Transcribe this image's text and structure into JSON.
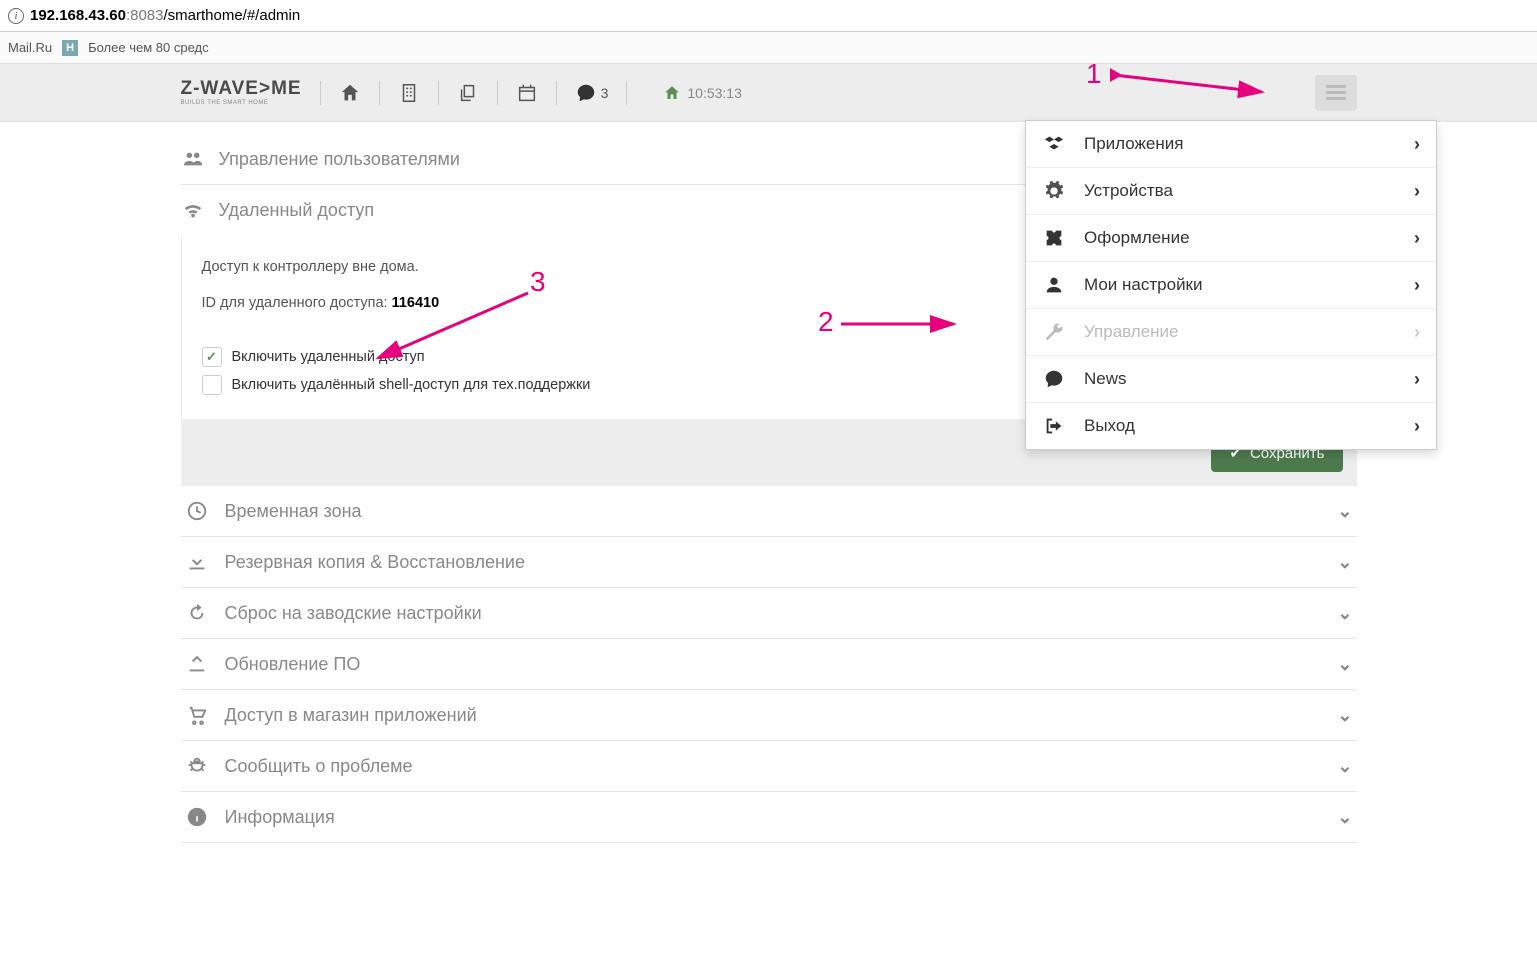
{
  "address": {
    "ip": "192.168.43.60",
    "port": ":8083",
    "path": "/smarthome/#/admin"
  },
  "bookmarks": {
    "mailru": "Mail.Ru",
    "more": "Более чем 80 средс"
  },
  "logo": {
    "main": "Z-WAVE>ME",
    "sub": "BUILDS THE SMART HOME"
  },
  "topnav": {
    "msg_count": "3",
    "time": "10:53:13"
  },
  "menu": {
    "apps": "Приложения",
    "devices": "Устройства",
    "design": "Оформление",
    "settings": "Мои настройки",
    "admin": "Управление",
    "news": "News",
    "logout": "Выход"
  },
  "sections": {
    "users": "Управление пользователями",
    "remote": "Удаленный доступ"
  },
  "remote": {
    "desc": "Доступ к контроллеру вне дома.",
    "id_label": "ID для удаленного доступа: ",
    "id_value": "116410",
    "chk1": "Включить удаленный доступ",
    "chk2": "Включить удалённый shell-доступ для тех.поддержки",
    "save": "Сохранить"
  },
  "rows": {
    "tz": "Временная зона",
    "backup": "Резервная копия & Восстановление",
    "reset": "Сброс на заводские настройки",
    "update": "Обновление ПО",
    "store": "Доступ в магазин приложений",
    "bug": "Сообщить о проблеме",
    "info": "Информация"
  },
  "annot": {
    "n1": "1",
    "n2": "2",
    "n3": "3"
  }
}
